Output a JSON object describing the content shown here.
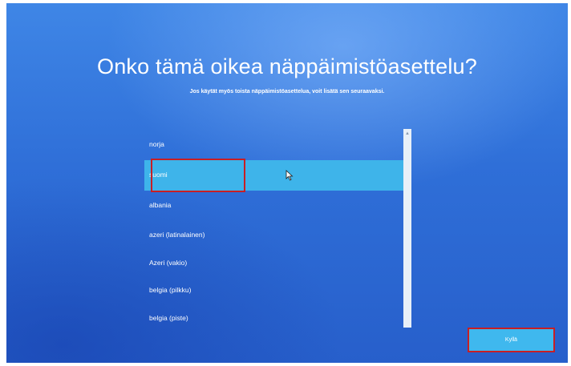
{
  "title": "Onko tämä oikea näppäimistöasettelu?",
  "subtitle": "Jos käytät myös toista näppäimistöasettelua, voit lisätä sen seuraavaksi.",
  "layouts": [
    {
      "label": "norja",
      "selected": false
    },
    {
      "label": "suomi",
      "selected": true
    },
    {
      "label": "albania",
      "selected": false
    },
    {
      "label": "azeri (latinalainen)",
      "selected": false
    },
    {
      "label": "Azeri (vakio)",
      "selected": false
    },
    {
      "label": "belgia (pilkku)",
      "selected": false
    },
    {
      "label": "belgia (piste)",
      "selected": false
    }
  ],
  "yes_button": {
    "label": "Kyllä"
  },
  "colors": {
    "background": "#2f6fd8",
    "selection": "#3eb4ea",
    "button": "#3fb8ee",
    "highlight_box": "#c81e24"
  },
  "icons": {
    "scroll_up": "chevron-up-icon",
    "cursor": "mouse-pointer-icon"
  }
}
